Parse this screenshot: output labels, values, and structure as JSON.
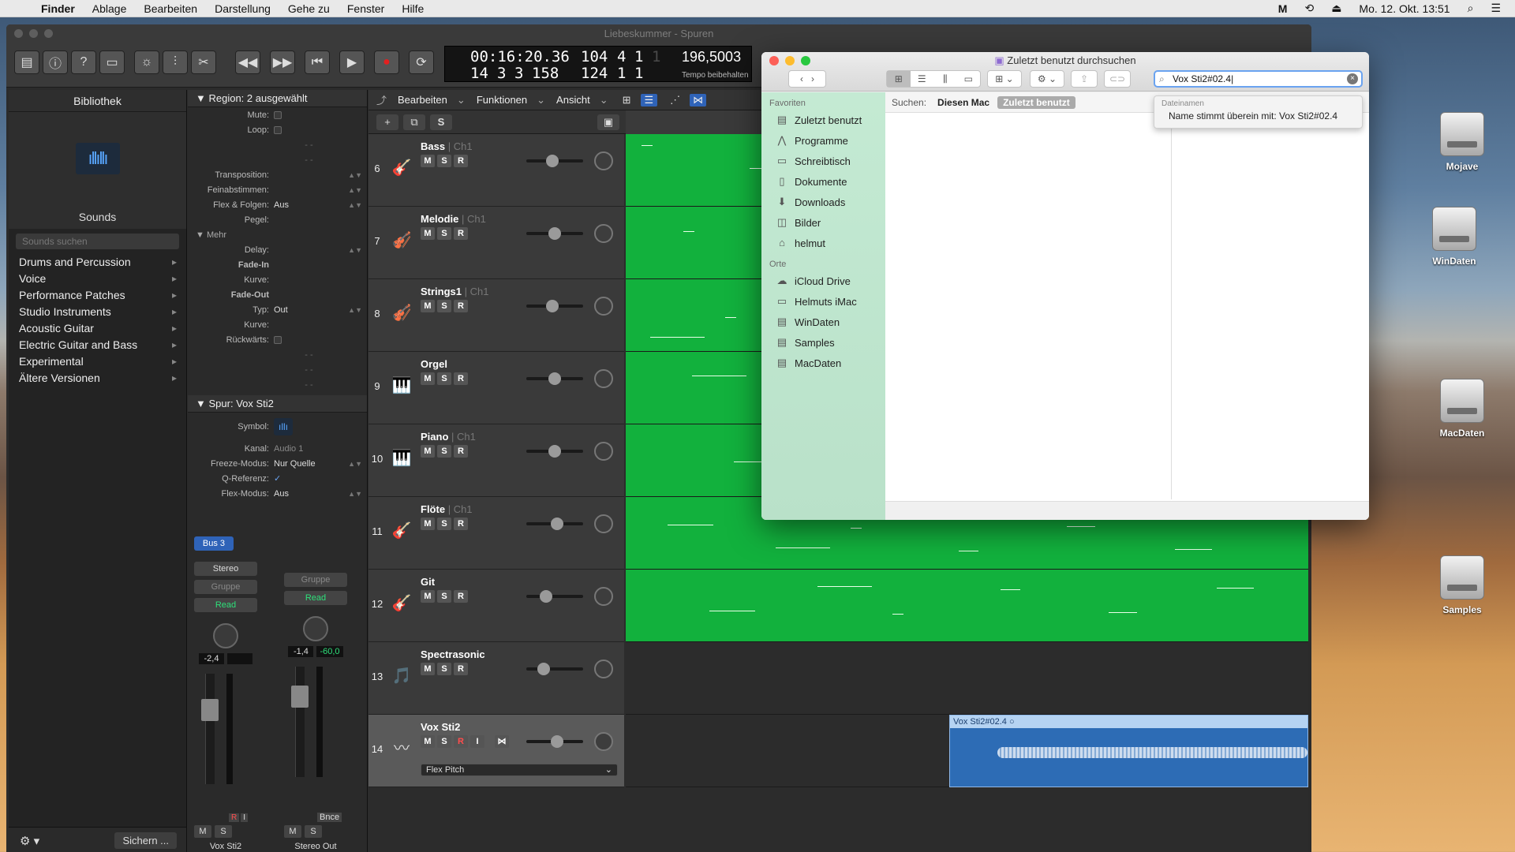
{
  "menubar": {
    "app": "Finder",
    "items": [
      "Ablage",
      "Bearbeiten",
      "Darstellung",
      "Gehe zu",
      "Fenster",
      "Hilfe"
    ],
    "clock": "Mo. 12. Okt.  13:51",
    "icons": [
      "apple-icon",
      "m-status-icon",
      "time-machine-icon",
      "eject-icon",
      "search-icon",
      "control-center-icon"
    ]
  },
  "desktop": {
    "icons": [
      {
        "label": "Mojave"
      },
      {
        "label": "WinDaten"
      },
      {
        "label": "MacDaten"
      },
      {
        "label": "Samples"
      }
    ]
  },
  "logic": {
    "title": "Liebeskummer - Spuren",
    "lcd": {
      "position": "00:16:20.36",
      "bars": "104",
      "beat": "4",
      "div": "1",
      "tick": "1",
      "pos2a": "14",
      "pos2b": "3",
      "pos2c": "3",
      "pos2d": "158",
      "end_bars": "124",
      "end_beat": "1",
      "end_div": "1",
      "tempo": "196,5003",
      "tempo_label": "Tempo beibehalten"
    },
    "library": {
      "title": "Bibliothek",
      "sounds_label": "Sounds",
      "search_placeholder": "Sounds suchen",
      "categories": [
        "Drums and Percussion",
        "Voice",
        "Performance Patches",
        "Studio Instruments",
        "Acoustic Guitar",
        "Electric Guitar and Bass",
        "Experimental",
        "Ältere Versionen"
      ],
      "save_label": "Sichern ..."
    },
    "inspector": {
      "region_header": "Region:",
      "region_value": "2 ausgewählt",
      "rows": {
        "mute": "Mute:",
        "loop": "Loop:",
        "transposition": "Transposition:",
        "fine": "Feinabstimmen:",
        "flex": "Flex & Folgen:",
        "flex_value": "Aus",
        "level": "Pegel:",
        "more": "Mehr",
        "delay": "Delay:",
        "fadein": "Fade-In",
        "curve": "Kurve:",
        "fadeout": "Fade-Out",
        "type": "Typ:",
        "type_value": "Out",
        "curve2": "Kurve:",
        "reverse": "Rückwärts:"
      },
      "track_header": "Spur:",
      "track_value": "Vox Sti2",
      "track_rows": {
        "symbol": "Symbol:",
        "channel": "Kanal:",
        "channel_value": "Audio 1",
        "freeze": "Freeze-Modus:",
        "freeze_value": "Nur Quelle",
        "qref": "Q-Referenz:",
        "qref_value": "✓",
        "flexmode": "Flex-Modus:",
        "flexmode_value": "Aus"
      }
    },
    "strips": [
      {
        "bus": "Bus 3",
        "mode": "Stereo",
        "group": "Gruppe",
        "automation": "Read",
        "val1": "-2,4",
        "val2": "",
        "name": "Vox Sti2",
        "extra": "",
        "ri_r": "R",
        "ri_i": "I"
      },
      {
        "bus": "",
        "mode": "",
        "group": "Gruppe",
        "automation": "Read",
        "val1": "-1,4",
        "val2": "-60,0",
        "name": "Stereo Out",
        "extra": "Bnce",
        "ri_r": "",
        "ri_i": ""
      }
    ],
    "track_toolbar": {
      "edit": "Bearbeiten",
      "functions": "Funktionen",
      "view": "Ansicht"
    },
    "tracks": [
      {
        "num": "6",
        "name": "Bass",
        "ch": "Ch1",
        "icon": "bass-guitar-icon",
        "glyph": "🎸",
        "vol": 0.45,
        "rec": false
      },
      {
        "num": "7",
        "name": "Melodie",
        "ch": "Ch1",
        "icon": "violin-icon",
        "glyph": "🎻",
        "vol": 0.5,
        "rec": false
      },
      {
        "num": "8",
        "name": "Strings1",
        "ch": "Ch1",
        "icon": "strings-icon",
        "glyph": "🎻",
        "vol": 0.45,
        "rec": false
      },
      {
        "num": "9",
        "name": "Orgel",
        "ch": "",
        "icon": "organ-icon",
        "glyph": "🎹",
        "vol": 0.5,
        "rec": false
      },
      {
        "num": "10",
        "name": "Piano",
        "ch": "Ch1",
        "icon": "piano-icon",
        "glyph": "🎹",
        "vol": 0.5,
        "rec": false
      },
      {
        "num": "11",
        "name": "Flöte",
        "ch": "Ch1",
        "icon": "flute-icon",
        "glyph": "🎸",
        "vol": 0.55,
        "rec": false
      },
      {
        "num": "12",
        "name": "Git",
        "ch": "",
        "icon": "guitar-icon",
        "glyph": "🎸",
        "vol": 0.3,
        "rec": false
      },
      {
        "num": "13",
        "name": "Spectrasonic",
        "ch": "",
        "icon": "music-note-icon",
        "glyph": "🎵",
        "vol": 0.25,
        "rec": false
      },
      {
        "num": "14",
        "name": "Vox Sti2",
        "ch": "",
        "icon": "waveform-icon",
        "glyph": "〰",
        "vol": 0.55,
        "rec": true
      }
    ],
    "vox_region": {
      "name": "Vox Sti2#02.4",
      "flex": "Flex Pitch"
    }
  },
  "finder": {
    "title": "Zuletzt benutzt durchsuchen",
    "search_value": "Vox Sti2#02.4",
    "suggestion_category": "Dateinamen",
    "suggestion_text": "Name stimmt überein mit: Vox Sti2#02.4",
    "scope_label": "Suchen:",
    "scope_mac": "Diesen Mac",
    "scope_recent": "Zuletzt benutzt",
    "favorites_header": "Favoriten",
    "favorites": [
      {
        "label": "Zuletzt benutzt",
        "icon": "recents-icon",
        "glyph": "▤"
      },
      {
        "label": "Programme",
        "icon": "applications-icon",
        "glyph": "⋀"
      },
      {
        "label": "Schreibtisch",
        "icon": "desktop-icon",
        "glyph": "▭"
      },
      {
        "label": "Dokumente",
        "icon": "documents-icon",
        "glyph": "▯"
      },
      {
        "label": "Downloads",
        "icon": "downloads-icon",
        "glyph": "⬇"
      },
      {
        "label": "Bilder",
        "icon": "pictures-icon",
        "glyph": "◫"
      },
      {
        "label": "helmut",
        "icon": "home-icon",
        "glyph": "⌂"
      }
    ],
    "places_header": "Orte",
    "places": [
      {
        "label": "iCloud Drive",
        "icon": "cloud-icon",
        "glyph": "☁"
      },
      {
        "label": "Helmuts iMac",
        "icon": "imac-icon",
        "glyph": "▭"
      },
      {
        "label": "WinDaten",
        "icon": "disk-icon",
        "glyph": "▤"
      },
      {
        "label": "Samples",
        "icon": "disk-icon",
        "glyph": "▤"
      },
      {
        "label": "MacDaten",
        "icon": "disk-icon",
        "glyph": "▤"
      }
    ]
  }
}
